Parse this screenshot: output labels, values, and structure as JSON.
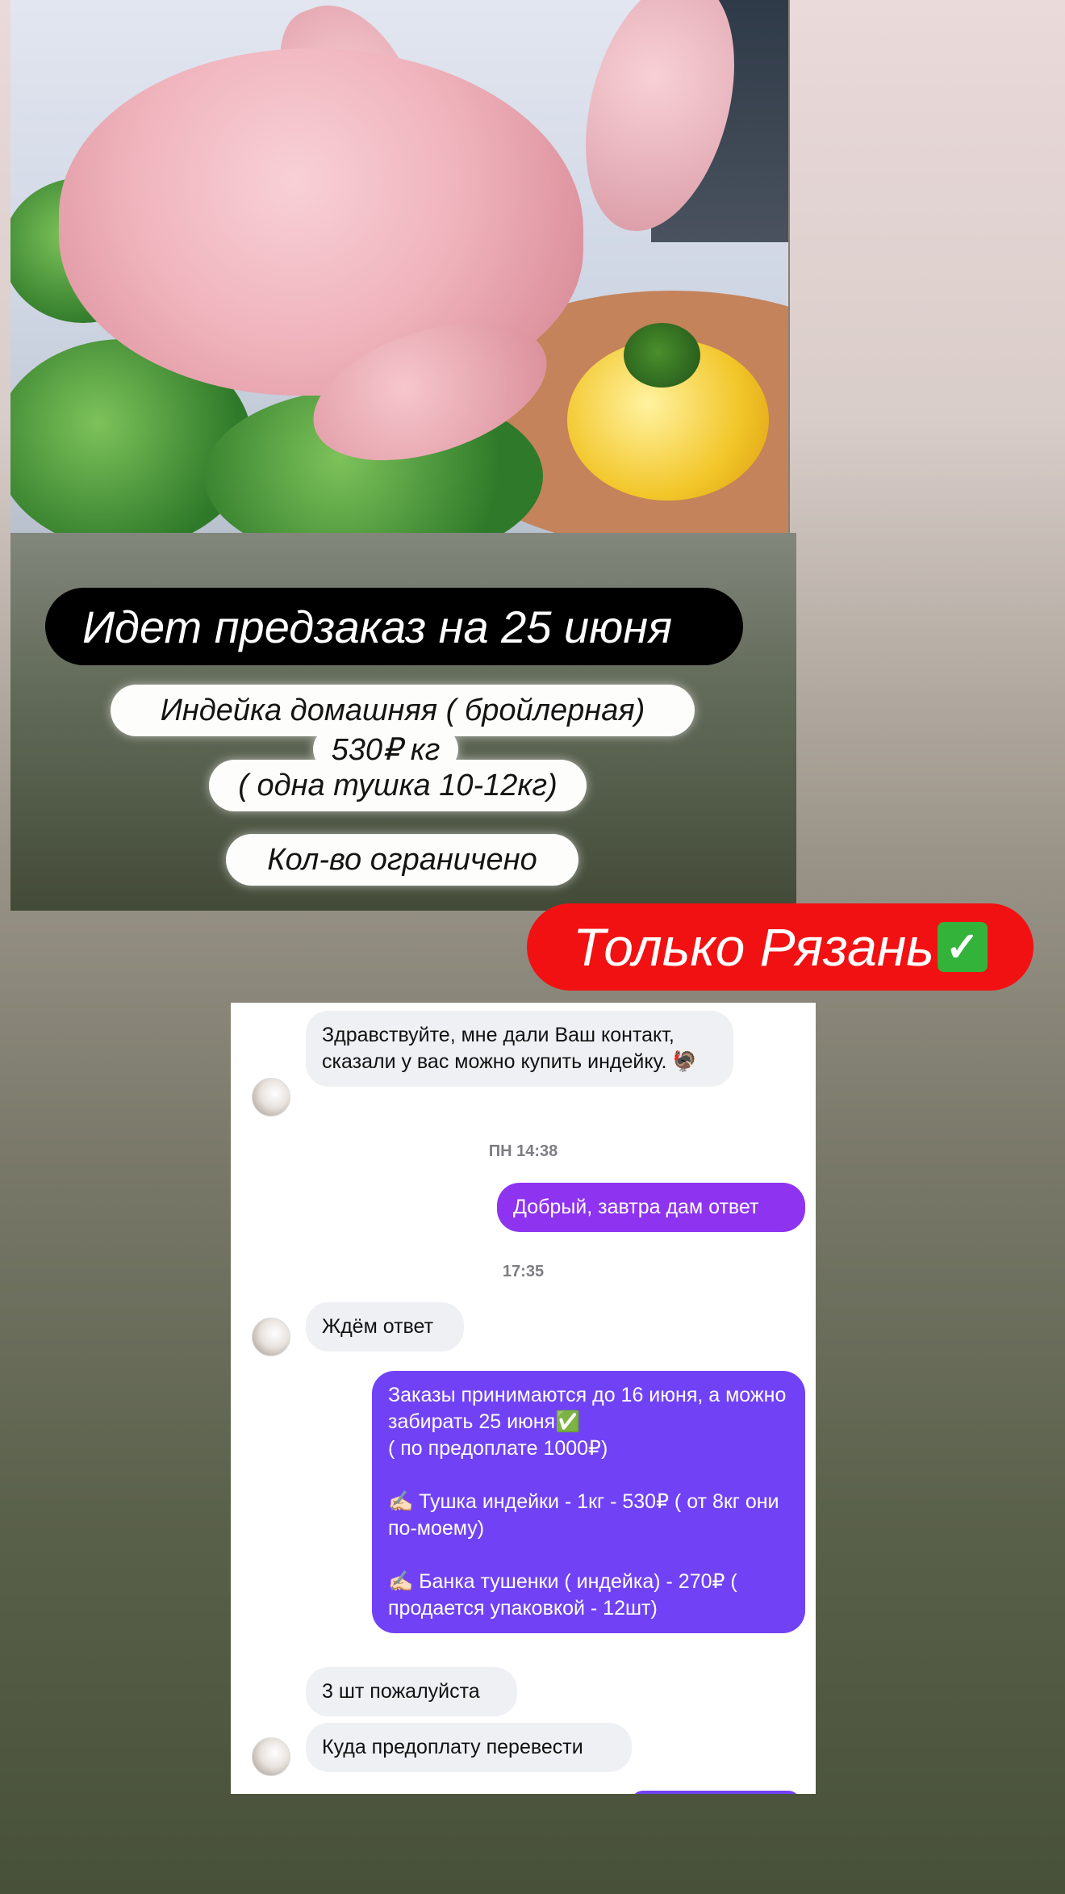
{
  "promo": {
    "title": "Идет предзаказ на 25 июня",
    "line1": "Индейка домашняя ( бройлерная)",
    "line2": "530₽ кг",
    "line3": "( одна тушка 10-12кг)",
    "line4": "Кол-во ограничено",
    "region": "Только Рязань",
    "region_icon": "check-mark-button-icon"
  },
  "chat": {
    "messages": [
      {
        "dir": "in",
        "text": "Здравствуйте, мне дали Ваш контакт, сказали у вас можно купить индейку. 🦃"
      },
      {
        "dir": "out",
        "text": "Добрый, завтра дам ответ"
      },
      {
        "dir": "in",
        "text": "Ждём ответ"
      },
      {
        "dir": "out",
        "text": "Заказы принимаются до 16 июня, а можно забирать 25 июня✅\n( по предоплате 1000₽)\n\n✍🏻 Тушка индейки - 1кг - 530₽ ( от 8кг они по-моему)\n\n✍🏻 Банка тушенки ( индейка) - 270₽ ( продается упаковкой - 12шт)"
      },
      {
        "dir": "in",
        "text": "3 шт пожалуйста"
      },
      {
        "dir": "in",
        "text": "Куда предоплату перевести"
      }
    ],
    "timestamps": [
      "ПН 14:38",
      "17:35"
    ]
  },
  "colors": {
    "title_pill": "#000000",
    "region_pill": "#f21112",
    "outgoing_bubble_1": "#8e33f0",
    "outgoing_bubble_2": "#7142f5",
    "incoming_bubble": "#eff0f3"
  }
}
